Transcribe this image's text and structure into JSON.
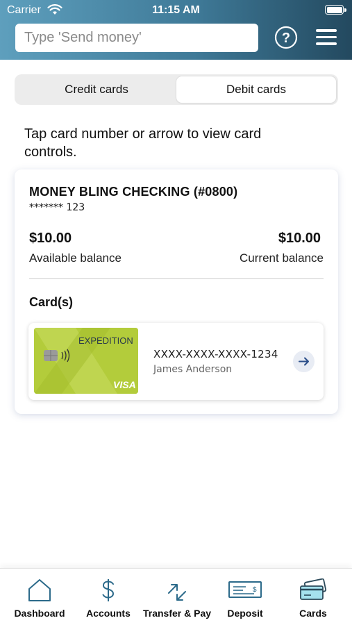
{
  "status_bar": {
    "carrier": "Carrier",
    "time": "11:15 AM"
  },
  "header": {
    "search_placeholder": "Type 'Send money'",
    "help_icon": "question-circle-icon",
    "menu_icon": "hamburger-menu-icon"
  },
  "segment": {
    "options": [
      "Credit cards",
      "Debit cards"
    ],
    "selected": "Debit cards"
  },
  "instructions": "Tap card number or arrow to view card controls.",
  "account": {
    "name": "MONEY BLING CHECKING (#0800)",
    "masked_number": "******* 123",
    "available_balance": "$10.00",
    "available_label": "Available balance",
    "current_balance": "$10.00",
    "current_label": "Current balance",
    "cards_heading": "Card(s)",
    "cards": [
      {
        "number": "XXXX-XXXX-XXXX-1234",
        "holder": "James Anderson",
        "brand": "EXPEDITION",
        "network": "VISA",
        "color": "#b3cc3b"
      }
    ]
  },
  "tab_bar": {
    "active": "Cards",
    "items": [
      {
        "label": "Dashboard",
        "icon": "house-icon"
      },
      {
        "label": "Accounts",
        "icon": "dollar-icon"
      },
      {
        "label": "Transfer & Pay",
        "icon": "transfer-arrows-icon"
      },
      {
        "label": "Deposit",
        "icon": "check-deposit-icon"
      },
      {
        "label": "Cards",
        "icon": "cards-icon"
      }
    ]
  },
  "colors": {
    "header_start": "#5e9fbd",
    "header_end": "#23495f",
    "icon_blue": "#2c6a8a",
    "active_tab": "#a5e1ee",
    "card_green": "#b3cc3b"
  }
}
